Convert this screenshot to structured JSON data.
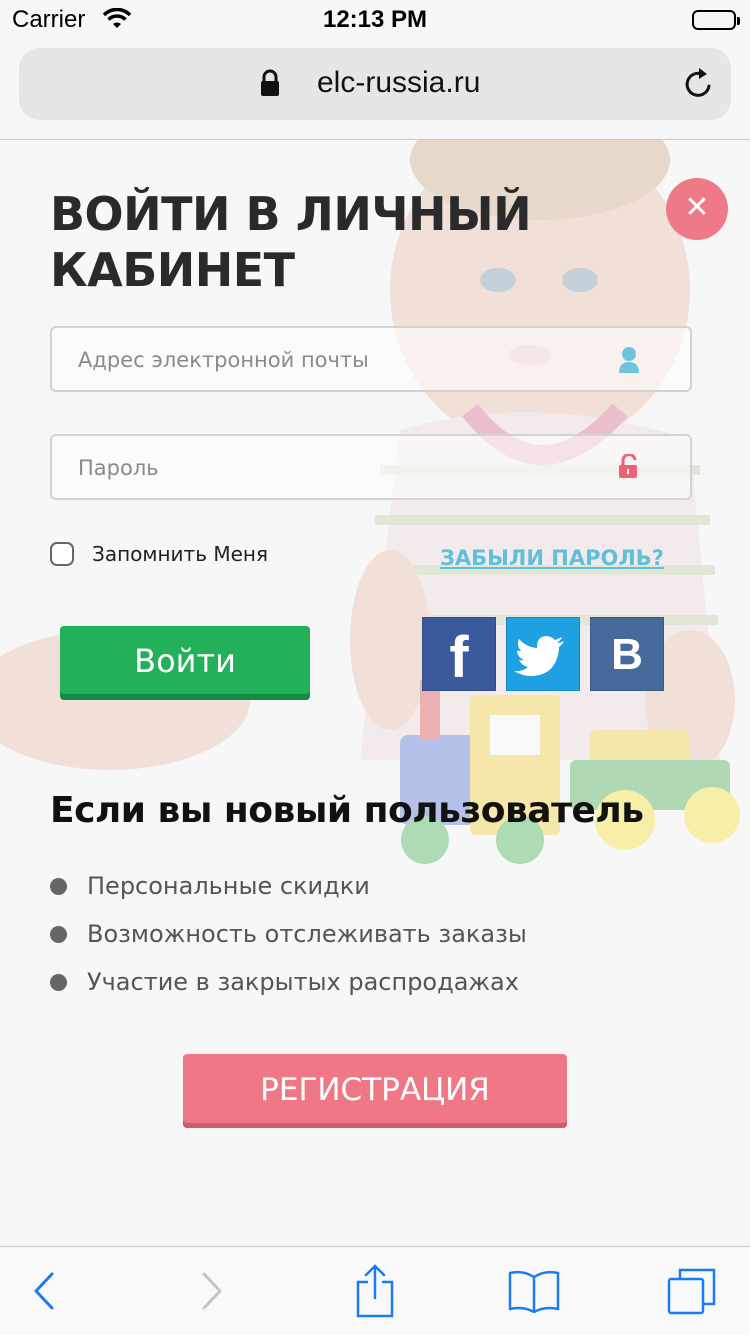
{
  "status_bar": {
    "carrier": "Carrier",
    "time": "12:13 PM"
  },
  "browser": {
    "url": "elc-russia.ru"
  },
  "login": {
    "title": "ВОЙТИ В ЛИЧНЫЙ КАБИНЕТ",
    "email_placeholder": "Адрес электронной почты",
    "password_placeholder": "Пароль",
    "remember_label": "Запомнить Меня",
    "forgot_label": "ЗАБЫЛИ ПАРОЛЬ?",
    "login_button": "Войти",
    "social": {
      "facebook": "f",
      "vk": "B"
    }
  },
  "new_user": {
    "heading": "Если вы новый пользователь",
    "benefits": [
      "Персональные скидки",
      "Возможность отслеживать заказы",
      "Участие в закрытых распродажах"
    ],
    "register_button": "РЕГИСТРАЦИЯ"
  },
  "colors": {
    "accent_green": "#22b159",
    "accent_pink": "#f07886",
    "link_blue": "#5fc0dc",
    "ios_blue": "#1a73e8"
  },
  "icons": [
    "wifi-icon",
    "lock-icon",
    "reload-icon",
    "close-icon",
    "user-icon",
    "unlock-icon",
    "facebook-icon",
    "twitter-icon",
    "vk-icon",
    "back-icon",
    "forward-icon",
    "share-icon",
    "bookmarks-icon",
    "tabs-icon"
  ]
}
